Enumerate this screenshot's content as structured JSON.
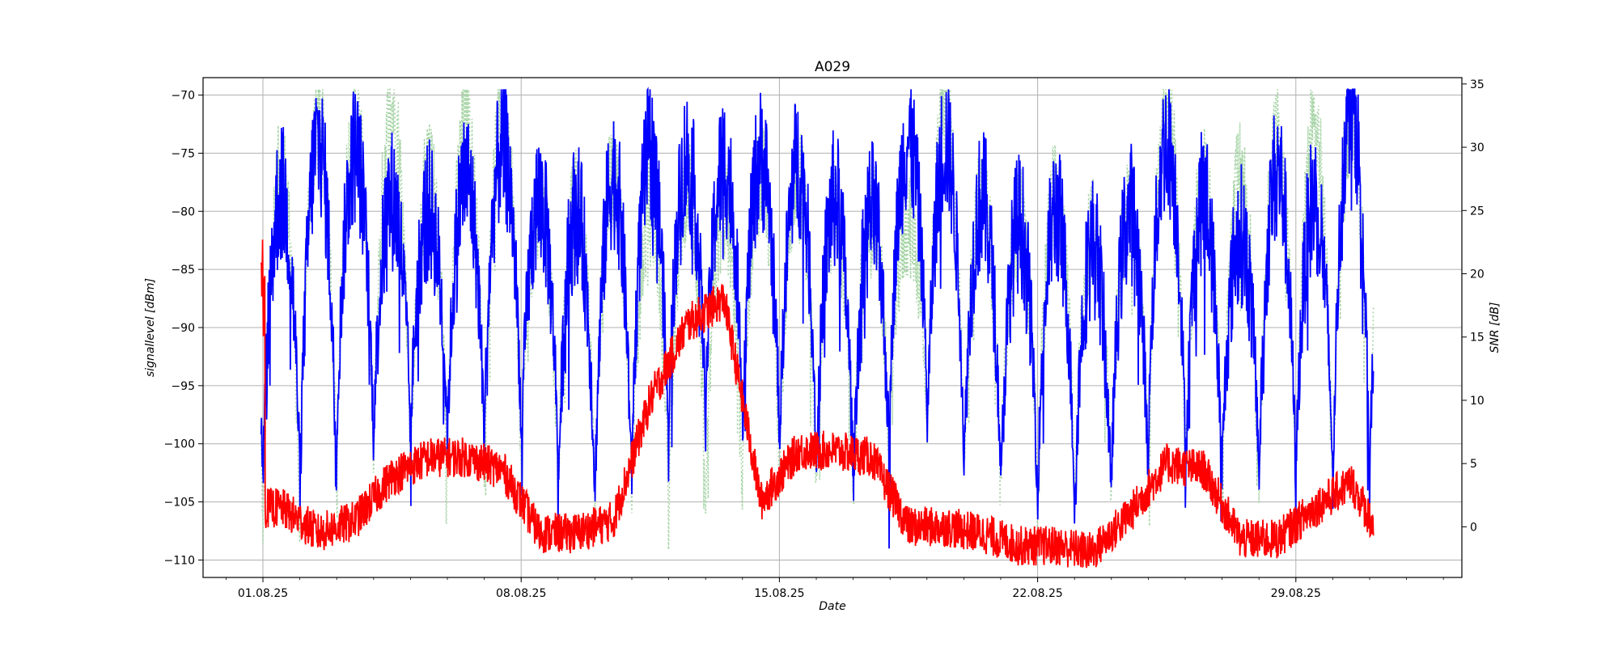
{
  "chart_data": {
    "type": "line",
    "title": "A029",
    "xlabel": "Date",
    "ylabel_left": "signallevel [dBm]",
    "ylabel_right": "SNR [dB]",
    "x_range_days": [
      "01.08.25",
      "31.08.25"
    ],
    "x_tick_labels": [
      "01.08.25",
      "08.08.25",
      "15.08.25",
      "22.08.25",
      "29.08.25"
    ],
    "x_tick_dates": [
      "2025-08-01",
      "2025-08-08",
      "2025-08-15",
      "2025-08-22",
      "2025-08-29"
    ],
    "ylim_left": [
      -111.5,
      -68.5
    ],
    "yticks_left": [
      -110,
      -105,
      -100,
      -95,
      -90,
      -85,
      -80,
      -75,
      -70
    ],
    "ylim_right": [
      -4.0,
      35.5
    ],
    "yticks_right": [
      0,
      5,
      10,
      15,
      20,
      25,
      30,
      35
    ],
    "grid": true,
    "series": [
      {
        "axis": "left",
        "color": "#0000ff",
        "style": "solid",
        "peak_dates": [
          "2025-08-01",
          "2025-08-02",
          "2025-08-03",
          "2025-08-04",
          "2025-08-05",
          "2025-08-06",
          "2025-08-07",
          "2025-08-08",
          "2025-08-09",
          "2025-08-10",
          "2025-08-11",
          "2025-08-12",
          "2025-08-13",
          "2025-08-14",
          "2025-08-15",
          "2025-08-16",
          "2025-08-17",
          "2025-08-18",
          "2025-08-19",
          "2025-08-20",
          "2025-08-21",
          "2025-08-22",
          "2025-08-23",
          "2025-08-24",
          "2025-08-25",
          "2025-08-26",
          "2025-08-27",
          "2025-08-28",
          "2025-08-29",
          "2025-08-30",
          "2025-08-31"
        ],
        "daily_peaks": [
          -78.5,
          -74,
          -75,
          -79,
          -80,
          -77,
          -74.5,
          -79,
          -80,
          -77,
          -75,
          -75.5,
          -76,
          -75.5,
          -76,
          -79,
          -80,
          -74,
          -74,
          -79,
          -81,
          -80,
          -83,
          -80,
          -74,
          -79,
          -82,
          -76.5,
          -79,
          -70.5,
          -77.5
        ],
        "daily_troughs": [
          -104,
          -106,
          -101,
          -100,
          -100,
          -101,
          -100,
          -102,
          -106,
          -106,
          -103,
          -99,
          -98,
          -100,
          -102,
          -104,
          -105,
          -97,
          -102,
          -104,
          -106,
          -106,
          -107,
          -104,
          -101,
          -105,
          -103,
          -105,
          -104,
          -106,
          -103
        ]
      },
      {
        "axis": "right",
        "color": "#ff0000",
        "style": "solid",
        "peak_dates": [
          "2025-08-01",
          "2025-08-02",
          "2025-08-03",
          "2025-08-04",
          "2025-08-05",
          "2025-08-06",
          "2025-08-07",
          "2025-08-08",
          "2025-08-09",
          "2025-08-10",
          "2025-08-11",
          "2025-08-12",
          "2025-08-13",
          "2025-08-14",
          "2025-08-15",
          "2025-08-16",
          "2025-08-17",
          "2025-08-18",
          "2025-08-19",
          "2025-08-20",
          "2025-08-21",
          "2025-08-22",
          "2025-08-23",
          "2025-08-24",
          "2025-08-25",
          "2025-08-26",
          "2025-08-27",
          "2025-08-28",
          "2025-08-29",
          "2025-08-30",
          "2025-08-31"
        ],
        "daily_levels": [
          1.5,
          -0.5,
          0.5,
          4.0,
          5.5,
          5.5,
          4.5,
          -0.5,
          -0.5,
          0.5,
          10.0,
          16.0,
          18.0,
          2.0,
          6.0,
          6.0,
          5.5,
          0.0,
          0.0,
          -0.5,
          -1.5,
          -1.5,
          -2.0,
          1.0,
          5.0,
          4.5,
          -1.0,
          -1.0,
          1.5,
          3.5,
          -2.0
        ]
      },
      {
        "axis": "left",
        "color": "#a8d5a8",
        "style": "dotted",
        "peak_dates": [
          "2025-08-01",
          "2025-08-02",
          "2025-08-03",
          "2025-08-04",
          "2025-08-05",
          "2025-08-06",
          "2025-08-07",
          "2025-08-08",
          "2025-08-09",
          "2025-08-10",
          "2025-08-11",
          "2025-08-12",
          "2025-08-13",
          "2025-08-14",
          "2025-08-15",
          "2025-08-16",
          "2025-08-17",
          "2025-08-18",
          "2025-08-19",
          "2025-08-20",
          "2025-08-21",
          "2025-08-22",
          "2025-08-23",
          "2025-08-24",
          "2025-08-25",
          "2025-08-26",
          "2025-08-27",
          "2025-08-28",
          "2025-08-29",
          "2025-08-30",
          "2025-08-31"
        ],
        "daily_peaks": [
          -76.5,
          -72,
          -72,
          -71,
          -77,
          -73,
          -71,
          -79,
          -79,
          -77,
          -80,
          -78,
          -80,
          -77,
          -77,
          -80,
          -80,
          -81,
          -71,
          -79,
          -81,
          -78,
          -82,
          -80,
          -71,
          -77,
          -77,
          -74,
          -73,
          -72,
          -74
        ],
        "daily_troughs": [
          -109.5,
          -106,
          -105,
          -103,
          -104,
          -102,
          -104,
          -105,
          -106,
          -106,
          -107,
          -107,
          -107,
          -104,
          -105,
          -105,
          -106,
          -99,
          -103,
          -104,
          -105,
          -105,
          -106,
          -103,
          -104,
          -105,
          -106,
          -106,
          -106,
          -106,
          -103
        ]
      }
    ]
  }
}
